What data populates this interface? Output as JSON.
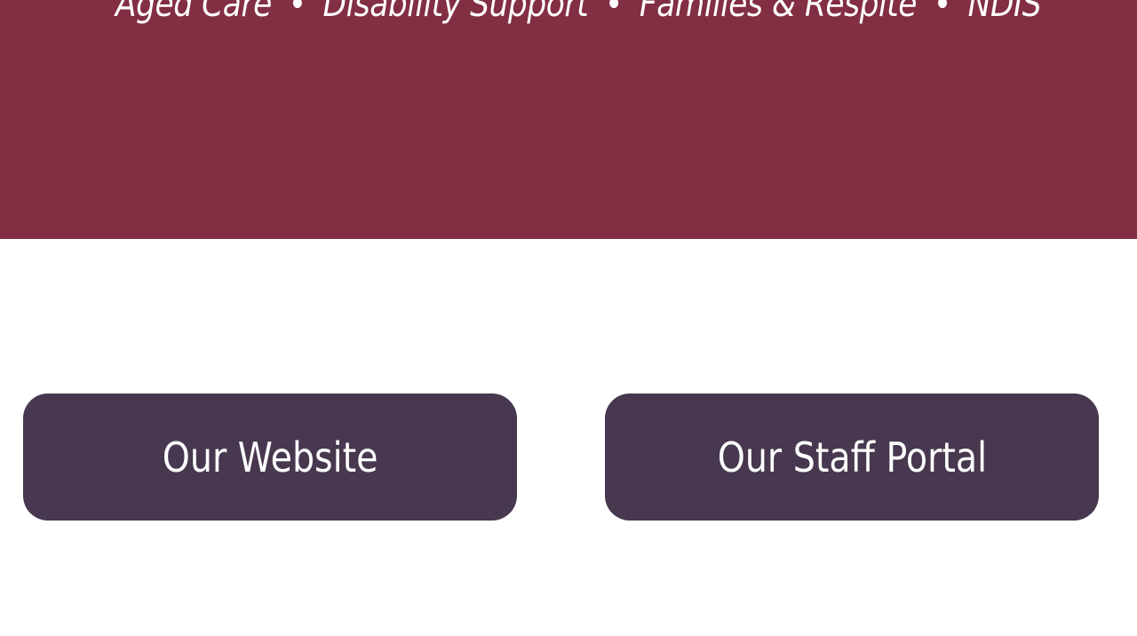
{
  "hero": {
    "background_color": "#822e43",
    "services": [
      "Aged Care",
      "Disability Support",
      "Families & Respite",
      "NDIS"
    ],
    "separator": "•"
  },
  "links": {
    "website_label": "Our Website",
    "staff_portal_label": "Our Staff Portal",
    "button_color": "#47374f"
  }
}
